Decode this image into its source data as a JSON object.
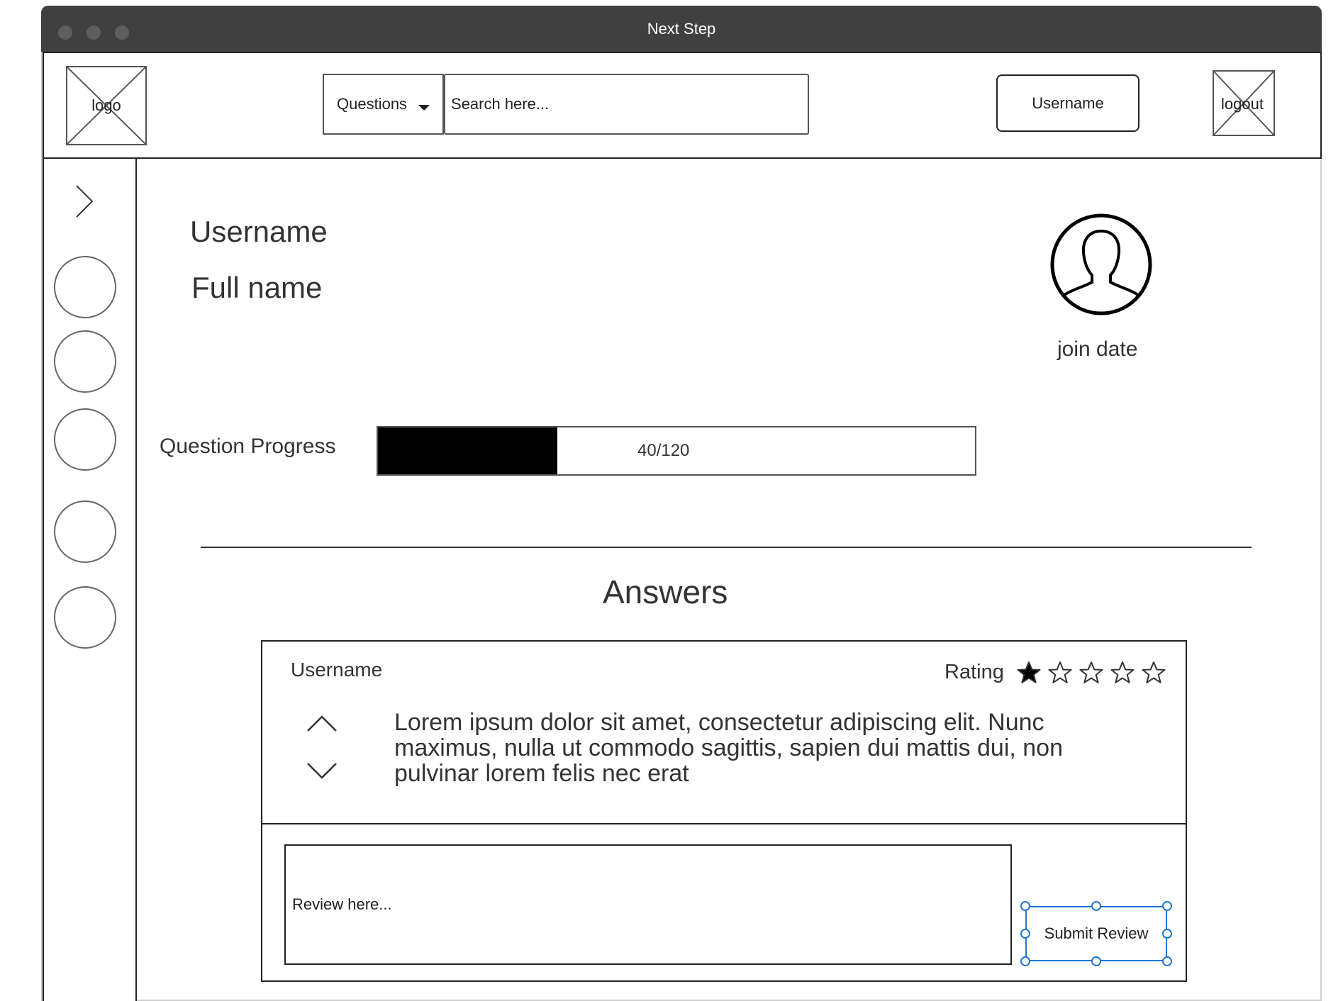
{
  "window": {
    "title": "Next Step"
  },
  "header": {
    "logo_label": "logo",
    "search_category": "Questions",
    "search_placeholder": "Search here...",
    "username_button": "Username",
    "logout_label": "logout"
  },
  "sidebar": {
    "items": [
      {
        "icon": "circle-placeholder"
      },
      {
        "icon": "circle-placeholder"
      },
      {
        "icon": "circle-placeholder"
      },
      {
        "icon": "circle-placeholder"
      },
      {
        "icon": "circle-placeholder"
      }
    ]
  },
  "profile": {
    "username": "Username",
    "full_name": "Full name",
    "join_date": "join date",
    "avatar_icon": "user-avatar-icon"
  },
  "progress": {
    "label": "Question Progress",
    "text": "40/120",
    "fraction": 0.3
  },
  "answers": {
    "heading": "Answers",
    "item": {
      "username": "Username",
      "rating_label": "Rating",
      "rating": 1,
      "rating_max": 5,
      "body": "Lorem ipsum dolor sit amet, consectetur adipiscing elit. Nunc maximus, nulla ut commodo sagittis, sapien dui mattis dui, non pulvinar lorem felis nec erat"
    },
    "review_placeholder": "Review here...",
    "submit_label": "Submit Review"
  },
  "colors": {
    "titlebar": "#404040",
    "selection": "#1f77d4",
    "progress_fill": "#000000"
  }
}
